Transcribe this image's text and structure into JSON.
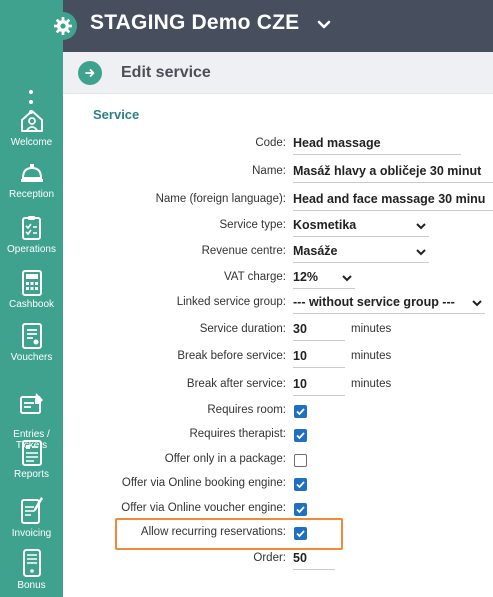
{
  "app": {
    "title": "STAGING Demo CZE"
  },
  "sidebar": {
    "items": [
      {
        "label": "Welcome",
        "icon": "home-icon"
      },
      {
        "label": "Reception",
        "icon": "bell-icon"
      },
      {
        "label": "Operations",
        "icon": "clipboard-icon"
      },
      {
        "label": "Cashbook",
        "icon": "calculator-icon"
      },
      {
        "label": "Vouchers",
        "icon": "voucher-icon"
      },
      {
        "label": "Entries /\nTickets",
        "icon": "ticket-icon"
      },
      {
        "label": "Reports",
        "icon": "reports-icon"
      },
      {
        "label": "Invoicing",
        "icon": "invoice-icon"
      },
      {
        "label": "Bonus",
        "icon": "phone-icon"
      }
    ]
  },
  "header": {
    "title": "Edit service"
  },
  "section": {
    "title": "Service"
  },
  "form": {
    "code": {
      "label": "Code:",
      "value": "Head massage"
    },
    "name": {
      "label": "Name:",
      "value": "Masáž hlavy a obličeje 30 minut"
    },
    "name_foreign": {
      "label": "Name (foreign language):",
      "value": "Head and face massage 30 minu"
    },
    "service_type": {
      "label": "Service type:",
      "value": "Kosmetika"
    },
    "revenue_centre": {
      "label": "Revenue centre:",
      "value": "Masáže"
    },
    "vat_charge": {
      "label": "VAT charge:",
      "value": "12%"
    },
    "linked_group": {
      "label": "Linked service group:",
      "value": "--- without service group ---"
    },
    "duration": {
      "label": "Service duration:",
      "value": "30",
      "unit": "minutes"
    },
    "break_before": {
      "label": "Break before service:",
      "value": "10",
      "unit": "minutes"
    },
    "break_after": {
      "label": "Break after service:",
      "value": "10",
      "unit": "minutes"
    },
    "requires_room": {
      "label": "Requires room:",
      "checked": true
    },
    "requires_therapist": {
      "label": "Requires therapist:",
      "checked": true
    },
    "package_only": {
      "label": "Offer only in a package:",
      "checked": false
    },
    "online_booking": {
      "label": "Offer via Online booking engine:",
      "checked": true
    },
    "online_voucher": {
      "label": "Offer via Online voucher engine:",
      "checked": true
    },
    "recurring": {
      "label": "Allow recurring reservations:",
      "checked": true
    },
    "order": {
      "label": "Order:",
      "value": "50"
    }
  },
  "colors": {
    "sidebar": "#3fa28f",
    "topbar": "#474f5e",
    "checkbox": "#1f6fc5",
    "highlight": "#f08a3a",
    "section_title": "#2f7f88"
  }
}
